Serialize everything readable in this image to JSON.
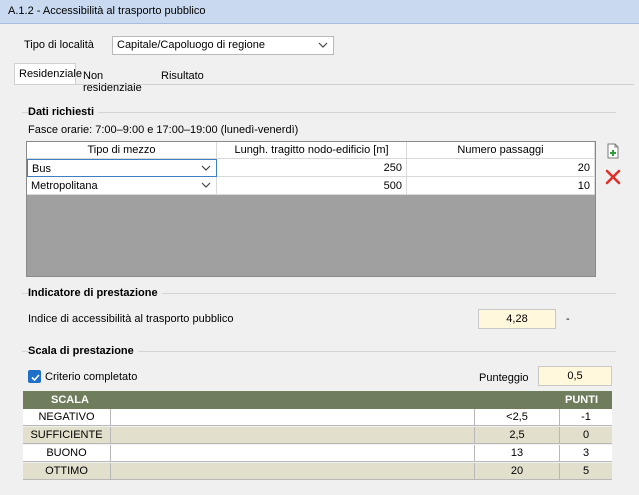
{
  "window": {
    "title": "A.1.2 - Accessibilità al trasporto pubblico"
  },
  "locality": {
    "label": "Tipo di località",
    "value": "Capitale/Capoluogo di regione"
  },
  "tabs": [
    {
      "label": "Residenziale",
      "active": true
    },
    {
      "label": "Non residenziale",
      "active": false
    },
    {
      "label": "Risultato",
      "active": false
    }
  ],
  "required": {
    "title": "Dati richiesti",
    "time_slots": "Fasce orarie: 7:00–9:00 e 17:00–19:00 (lunedì-venerdì)",
    "columns": [
      "Tipo di mezzo",
      "Lungh. tragitto nodo-edificio [m]",
      "Numero passaggi"
    ],
    "rows": [
      {
        "mezzo": "Bus",
        "lunghezza": "250",
        "passaggi": "20"
      },
      {
        "mezzo": "Metropolitana",
        "lunghezza": "500",
        "passaggi": "10"
      }
    ]
  },
  "indicator": {
    "title": "Indicatore di prestazione",
    "label": "Indice di accessibilità al trasporto pubblico",
    "value": "4,28",
    "unit": "-"
  },
  "scale": {
    "title": "Scala di prestazione",
    "criterio_label": "Criterio completato",
    "criterio_checked": true,
    "punteggio_label": "Punteggio",
    "punteggio_value": "0,5",
    "header_scala": "SCALA",
    "header_punti": "PUNTI",
    "rows": [
      {
        "name": "NEGATIVO",
        "threshold": "<2,5",
        "points": "-1"
      },
      {
        "name": "SUFFICIENTE",
        "threshold": "2,5",
        "points": "0"
      },
      {
        "name": "BUONO",
        "threshold": "13",
        "points": "3"
      },
      {
        "name": "OTTIMO",
        "threshold": "20",
        "points": "5"
      }
    ]
  },
  "colors": {
    "titlebar": "#c9daf0",
    "scale_header": "#6f7d5c",
    "value_box": "#fff8dc",
    "alt_row": "#e2dfcc",
    "delete": "#e0302a"
  }
}
